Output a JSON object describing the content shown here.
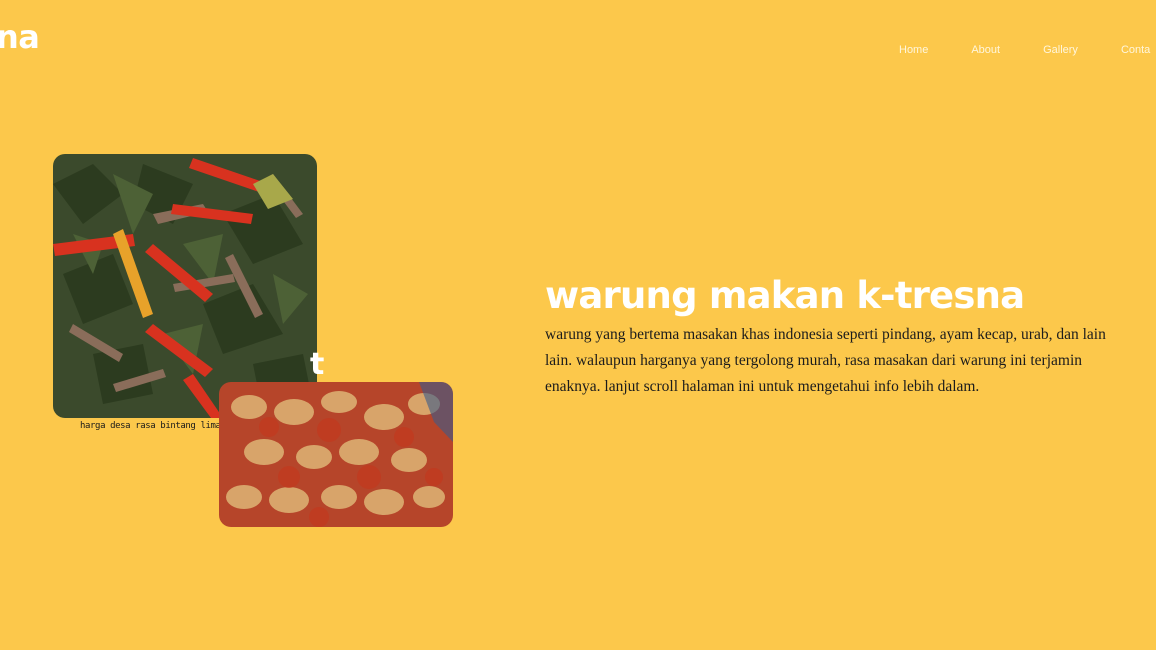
{
  "header": {
    "logo_text": "na",
    "nav": [
      {
        "label": "Home"
      },
      {
        "label": "About"
      },
      {
        "label": "Gallery"
      },
      {
        "label": "Conta"
      }
    ]
  },
  "hero": {
    "title": "warung makan k-tresna",
    "description": "warung yang bertema masakan khas indonesia seperti pindang, ayam kecap, urab, dan lain lain. walaupun harganya yang tergolong murah, rasa masakan dari warung ini terjamin enaknya. lanjut scroll halaman ini untuk mengetahui info lebih dalam.",
    "image_caption": "harga desa rasa bintang lima",
    "overlay_glyph": "t",
    "images": [
      {
        "name": "food-photo-vegetables-chili"
      },
      {
        "name": "food-photo-sambal"
      }
    ]
  },
  "colors": {
    "background": "#fcc84b",
    "heading": "#ffffff",
    "body_text": "#1c1c1c"
  }
}
